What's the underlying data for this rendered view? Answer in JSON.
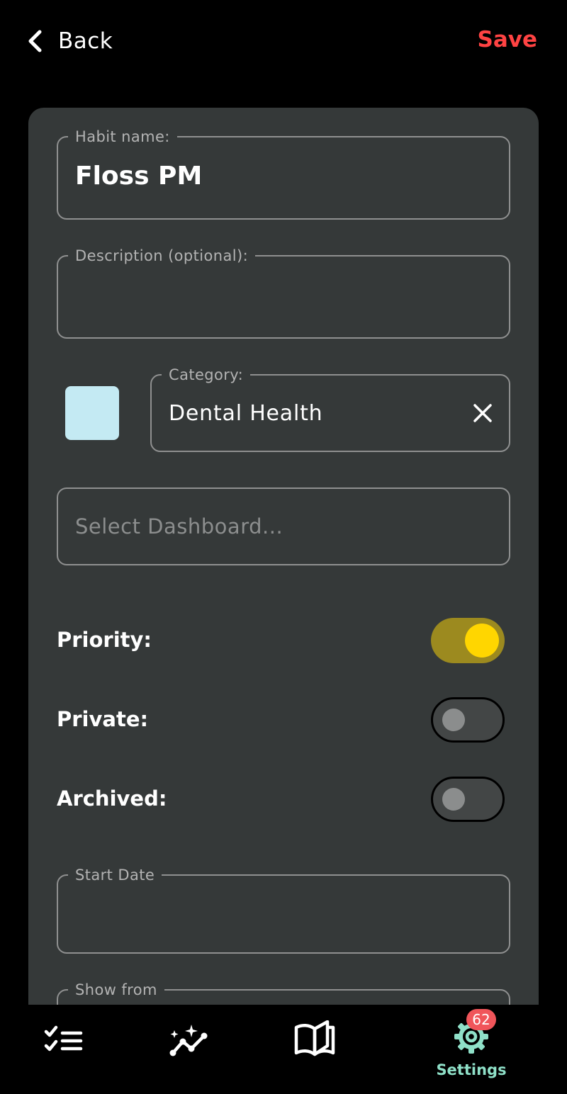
{
  "header": {
    "back_label": "Back",
    "save_label": "Save",
    "save_color": "#ff4343"
  },
  "form": {
    "habit_name": {
      "label": "Habit name:",
      "value": "Floss PM"
    },
    "description": {
      "label": "Description (optional):",
      "value": ""
    },
    "category": {
      "label": "Category:",
      "value": "Dental Health",
      "color": "#c4eaf3"
    },
    "dashboard": {
      "placeholder": "Select Dashboard..."
    },
    "toggles": [
      {
        "label": "Priority:",
        "on": true
      },
      {
        "label": "Private:",
        "on": false
      },
      {
        "label": "Archived:",
        "on": false
      }
    ],
    "start_date": {
      "label": "Start Date",
      "value": ""
    },
    "show_from": {
      "label": "Show from",
      "value": ""
    }
  },
  "nav": {
    "items": [
      {
        "name": "tasks",
        "icon": "checklist-icon"
      },
      {
        "name": "stats",
        "icon": "trend-sparkle-icon"
      },
      {
        "name": "journal",
        "icon": "open-book-icon"
      },
      {
        "name": "settings",
        "icon": "gear-icon",
        "label": "Settings",
        "badge": "62",
        "active": true
      }
    ],
    "active_color": "#8fe0c8",
    "badge_color": "#f0555a"
  }
}
